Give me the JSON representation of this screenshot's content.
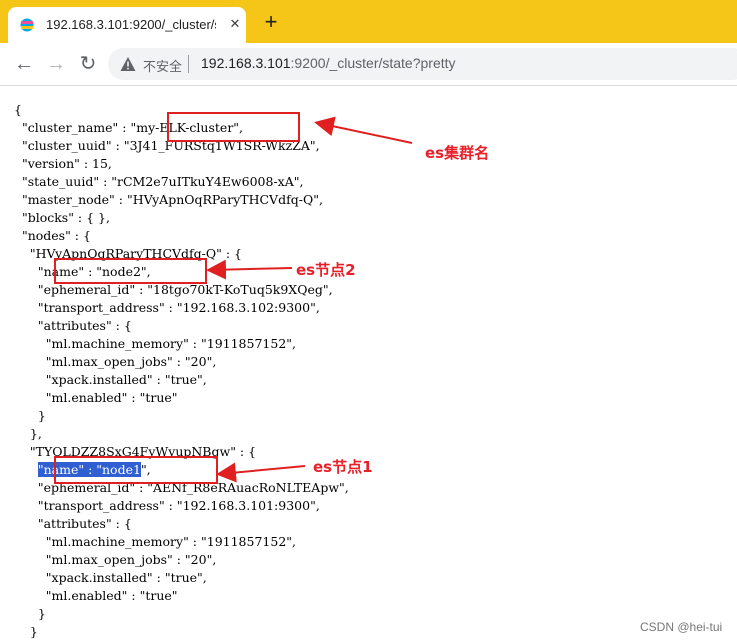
{
  "tab": {
    "title": "192.168.3.101:9200/_cluster/s",
    "close": "✕",
    "new_tab": "+"
  },
  "toolbar": {
    "back": "←",
    "forward": "→",
    "reload": "↻",
    "insecure_label": "不安全",
    "url_host": "192.168.3.101",
    "url_rest": ":9200/_cluster/state?pretty"
  },
  "json_lines": [
    "{",
    "  \"cluster_name\" : \"my-ELK-cluster\",",
    "  \"cluster_uuid\" : \"3J41_FURStq1W1SR-WkzZA\",",
    "  \"version\" : 15,",
    "  \"state_uuid\" : \"rCM2e7uITkuY4Ew6008-xA\",",
    "  \"master_node\" : \"HVyApnOqRParyTHCVdfq-Q\",",
    "  \"blocks\" : { },",
    "  \"nodes\" : {",
    "    \"HVyApnOqRParyTHCVdfq-Q\" : {",
    "      \"name\" : \"node2\",",
    "      \"ephemeral_id\" : \"18tgo70kT-KoTuq5k9XQeg\",",
    "      \"transport_address\" : \"192.168.3.102:9300\",",
    "      \"attributes\" : {",
    "        \"ml.machine_memory\" : \"1911857152\",",
    "        \"ml.max_open_jobs\" : \"20\",",
    "        \"xpack.installed\" : \"true\",",
    "        \"ml.enabled\" : \"true\"",
    "      }",
    "    },",
    "    \"TYOLDZZ8SxG4FyWvupNBgw\" : {",
    "      \"name\" : \"node1\",",
    "      \"ephemeral_id\" : \"AENf_R8eRAuacRoNLTEApw\",",
    "      \"transport_address\" : \"192.168.3.101:9300\",",
    "      \"attributes\" : {",
    "        \"ml.machine_memory\" : \"1911857152\",",
    "        \"ml.max_open_jobs\" : \"20\",",
    "        \"xpack.installed\" : \"true\",",
    "        \"ml.enabled\" : \"true\"",
    "      }",
    "    }"
  ],
  "selected_text": "\"name\" : \"node1",
  "annotations": {
    "cluster": "es集群名",
    "node2": "es节点2",
    "node1": "es节点1"
  },
  "watermark": "CSDN @hei-tui",
  "colors": {
    "tabbar": "#f5c518",
    "annotation": "#e02020",
    "selection": "#2f5fd0"
  }
}
